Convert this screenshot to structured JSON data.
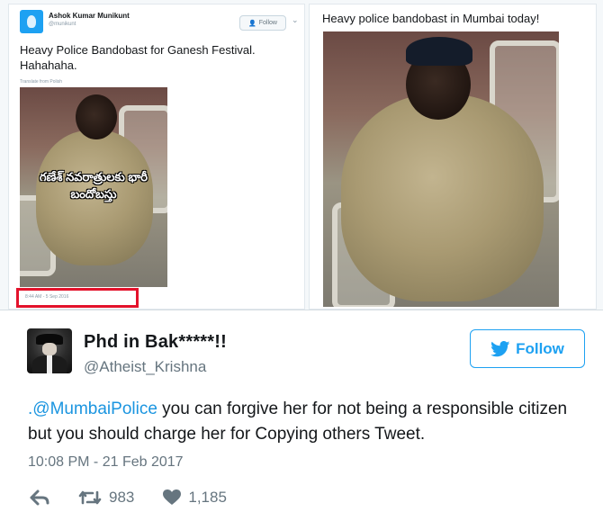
{
  "quoted_tweet": {
    "author_name": "Ashok Kumar Munikunt",
    "author_handle": "@munikunt",
    "follow_label": "Follow",
    "text": "Heavy Police Bandobast for Ganesh Festival. Hahahaha.",
    "translate_label": "Translate from Polish",
    "image_overlay": "గణేశ్ నవరాత్రులకు భారీ బందోబస్తు",
    "timestamp": "8:44 AM - 5 Sep 2016"
  },
  "right_image": {
    "caption": "Heavy police bandobast in Mumbai today!"
  },
  "tweet": {
    "display_name": "Phd in Bak*****!!",
    "handle": "@Atheist_Krishna",
    "follow_label": "Follow",
    "mention": ".@MumbaiPolice",
    "body": " you can forgive her for not being a responsible citizen but you should charge her for Copying others Tweet.",
    "timestamp": "10:08 PM - 21 Feb 2017",
    "retweet_count": "983",
    "like_count": "1,185"
  },
  "colors": {
    "brand": "#1da1f2",
    "mention": "#1b95e0",
    "highlight": "#e3122b",
    "muted": "#66757f"
  },
  "icons": [
    "reply-icon",
    "retweet-icon",
    "heart-icon",
    "twitter-bird-icon"
  ]
}
